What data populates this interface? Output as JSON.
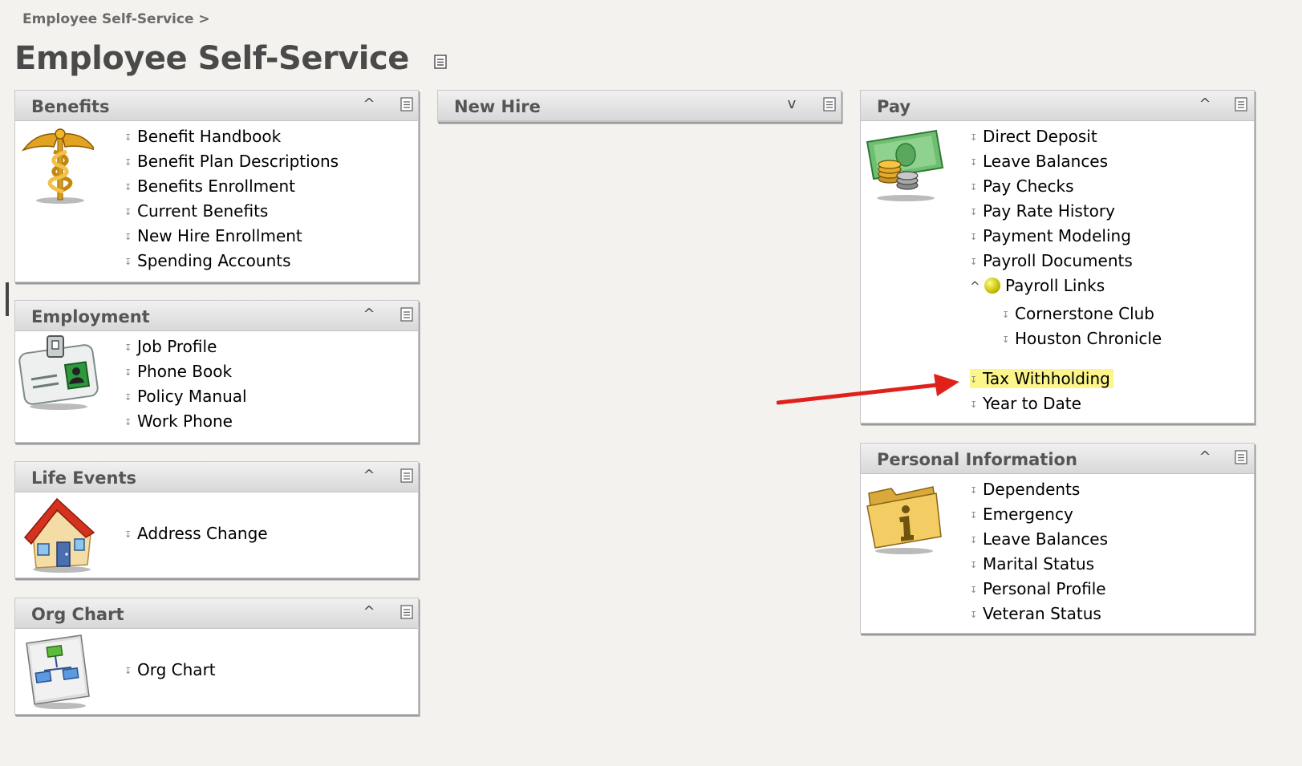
{
  "breadcrumb": "Employee Self-Service >",
  "page_title": "Employee Self-Service",
  "panels": {
    "benefits": {
      "title": "Benefits",
      "collapse_glyph": "^",
      "icon": "caduceus-icon",
      "links": [
        "Benefit Handbook",
        "Benefit Plan Descriptions",
        "Benefits Enrollment",
        "Current Benefits",
        "New Hire Enrollment",
        "Spending Accounts"
      ]
    },
    "employment": {
      "title": "Employment",
      "collapse_glyph": "^",
      "icon": "id-badge-icon",
      "links": [
        "Job Profile",
        "Phone Book",
        "Policy Manual",
        "Work Phone"
      ]
    },
    "life_events": {
      "title": "Life Events",
      "collapse_glyph": "^",
      "icon": "house-icon",
      "links": [
        "Address Change"
      ]
    },
    "org_chart": {
      "title": "Org Chart",
      "collapse_glyph": "^",
      "icon": "org-chart-icon",
      "links": [
        "Org Chart"
      ]
    },
    "new_hire": {
      "title": "New Hire",
      "collapse_glyph": "v"
    },
    "pay": {
      "title": "Pay",
      "collapse_glyph": "^",
      "icon": "money-coins-icon",
      "links": [
        "Direct Deposit",
        "Leave Balances",
        "Pay Checks",
        "Pay Rate History",
        "Payment Modeling",
        "Payroll Documents"
      ],
      "group": {
        "label": "Payroll Links",
        "expand_glyph": "^",
        "links": [
          "Cornerstone Club",
          "Houston Chronicle"
        ]
      },
      "links_after": [
        "Tax Withholding",
        "Year to Date"
      ],
      "highlighted": "Tax Withholding"
    },
    "personal_information": {
      "title": "Personal Information",
      "collapse_glyph": "^",
      "icon": "info-folder-icon",
      "links": [
        "Dependents",
        "Emergency",
        "Leave Balances",
        "Marital Status",
        "Personal Profile",
        "Veteran Status"
      ]
    }
  },
  "colors": {
    "page_background": "#f3f2ee",
    "header_gradient_top": "#f1f1f1",
    "header_gradient_bottom": "#d8d8d8",
    "highlight": "#fcf58a",
    "arrow": "#e0201b"
  }
}
